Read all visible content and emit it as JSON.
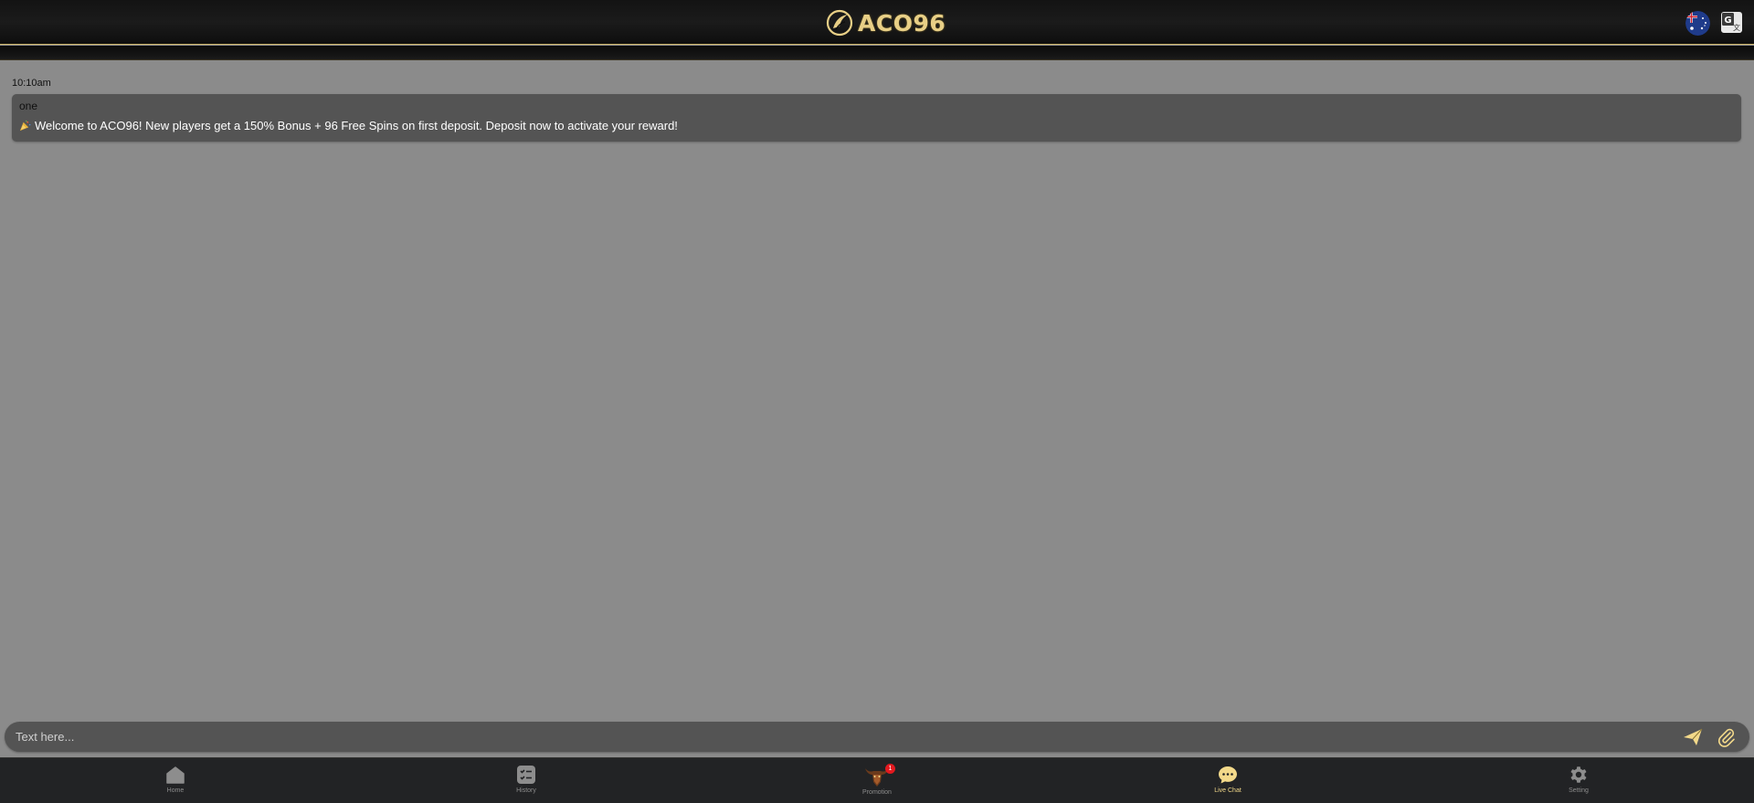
{
  "header": {
    "brand_name": "ACO96",
    "flag_icon": "australia-flag-icon",
    "translate_icon": "google-translate-icon",
    "accent_color": "#e8cf86"
  },
  "chat": {
    "timestamp": "10:10am",
    "messages": [
      {
        "sender": "one",
        "icon": "party-popper-icon",
        "text": "Welcome to ACO96! New players get a 150% Bonus + 96 Free Spins on first deposit. Deposit now to activate your reward!"
      }
    ]
  },
  "composer": {
    "placeholder": "Text here...",
    "send_icon": "send-icon",
    "attach_icon": "paperclip-icon"
  },
  "nav": {
    "items": [
      {
        "label": "Home",
        "icon": "home-icon",
        "active": false
      },
      {
        "label": "History",
        "icon": "history-checklist-icon",
        "active": false
      },
      {
        "label": "Promotion",
        "icon": "promotion-bull-icon",
        "active": false,
        "badge": "1"
      },
      {
        "label": "Live Chat",
        "icon": "chat-bubble-icon",
        "active": true
      },
      {
        "label": "Setting",
        "icon": "gear-icon",
        "active": false
      }
    ],
    "active_color": "#f3d98a",
    "inactive_color": "#8d8d8d"
  }
}
